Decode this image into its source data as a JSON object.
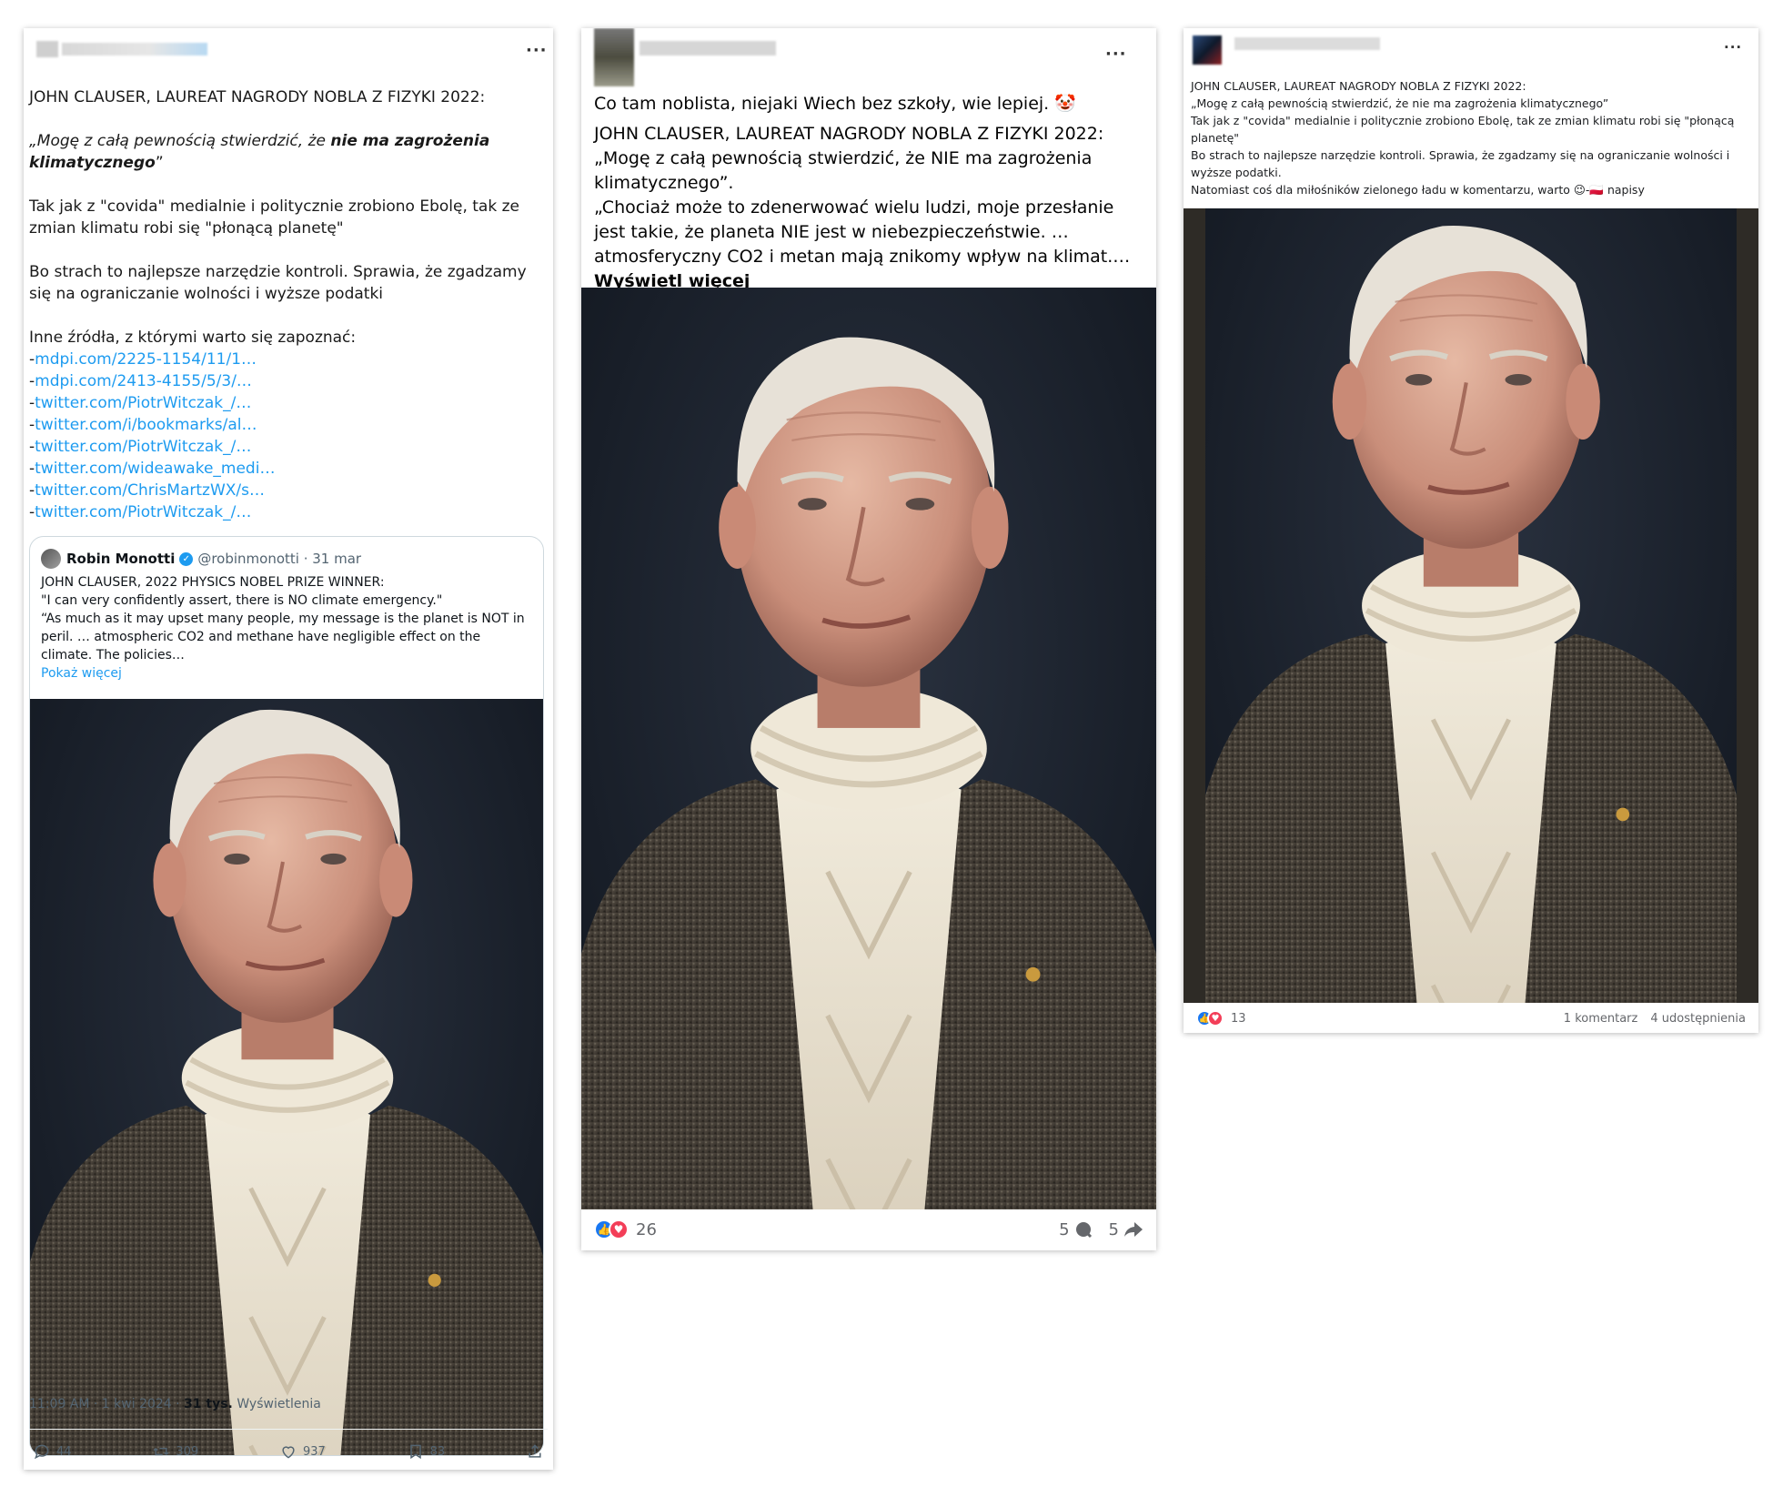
{
  "tweet": {
    "headline": "JOHN CLAUSER, LAUREAT NAGRODY NOBLA Z FIZYKI 2022:",
    "quote_open": "„Mogę z całą pewnością stwierdzić, że ",
    "quote_bold": "nie ma zagrożenia klimatycznego",
    "quote_close": "”",
    "para1": "Tak jak z \"covida\" medialnie i politycznie zrobiono Ebolę, tak ze zmian klimatu robi się \"płonącą planetę\"",
    "para2": "Bo strach to najlepsze narzędzie kontroli. Sprawia, że zgadzamy się na ograniczanie wolności i wyższe podatki",
    "sources_intro": "Inne źródła, z którymi warto się zapoznać:",
    "links": [
      "mdpi.com/2225-1154/11/1…",
      "mdpi.com/2413-4155/5/3/…",
      "twitter.com/PiotrWitczak_/…",
      "twitter.com/i/bookmarks/al…",
      "twitter.com/PiotrWitczak_/…",
      "twitter.com/wideawake_medi…",
      "twitter.com/ChrisMartzWX/s…",
      "twitter.com/PiotrWitczak_/…"
    ],
    "quoted": {
      "name": "Robin Monotti",
      "handle": "@robinmonotti · 31 mar",
      "line1": "JOHN CLAUSER, 2022 PHYSICS NOBEL PRIZE WINNER:",
      "line2": "\"I can very confidently assert, there is NO climate emergency.\"",
      "line3": "“As much as it may upset many people, my message is the planet is NOT in peril. … atmospheric CO2 and methane have negligible effect on the climate. The policies…",
      "show_more": "Pokaż więcej"
    },
    "time": "11:09 AM · 1 kwi 2024 · ",
    "views_count": "31 tys.",
    "views_label": " Wyświetlenia",
    "actions": {
      "replies": "44",
      "retweets": "309",
      "likes": "937",
      "bookmarks": "83"
    }
  },
  "fb_post_1": {
    "intro": "Co tam noblista, niejaki Wiech bez szkoły, wie lepiej. 🤡",
    "headline": "JOHN CLAUSER, LAUREAT NAGRODY NOBLA Z FIZYKI 2022:",
    "quote1": "„Mogę z całą pewnością stwierdzić, że NIE ma zagrożenia klimatycznego”.",
    "quote2": "„Chociaż może to zdenerwować wielu ludzi, moje przesłanie jest takie, że planeta NIE jest w niebezpieczeństwie. … atmosferyczny CO2 i metan mają znikomy wpływ na klimat.…",
    "see_more": "Wyświetl więcej",
    "reactions": "26",
    "comments": "5",
    "shares": "5"
  },
  "fb_post_2": {
    "line1": "JOHN CLAUSER, LAUREAT NAGRODY NOBLA Z FIZYKI 2022:",
    "line2": "„Mogę z całą pewnością stwierdzić, że nie ma zagrożenia klimatycznego”",
    "line3": "Tak jak z \"covida\" medialnie i politycznie zrobiono Ebolę, tak ze zmian klimatu robi się \"płonącą planetę\"",
    "line4": "Bo strach to najlepsze narzędzie kontroli. Sprawia, że zgadzamy się na ograniczanie wolności i wyższe podatki.",
    "line5_a": "Natomiast coś dla miłośników zielonego ładu w komentarzu, warto ",
    "line5_emoji": "😉-🇵🇱",
    "line5_b": " napisy",
    "reactions": "13",
    "comments": "1 komentarz",
    "shares": "4 udostępnienia"
  },
  "colors": {
    "link": "#1d9bf0",
    "fb_like": "#1877f2",
    "fb_love": "#f33e58"
  }
}
